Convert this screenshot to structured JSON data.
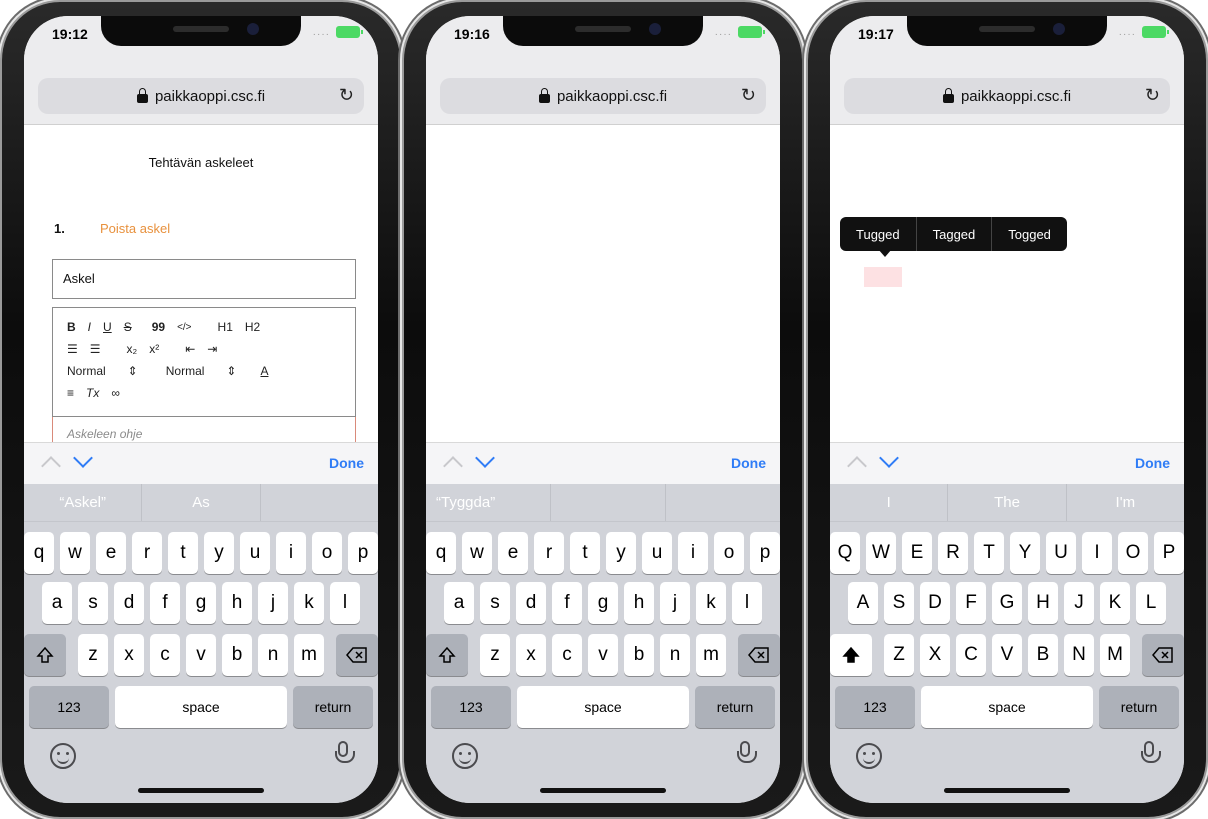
{
  "phones": [
    {
      "time": "19:12",
      "url": "paikkaoppi.csc.fi",
      "content": {
        "title": "Tehtävän askeleet",
        "step_number": "1.",
        "remove_step": "Poista askel",
        "input_value": "Askel",
        "toolbar": {
          "bold": "B",
          "italic": "I",
          "underline": "U",
          "strike": "S",
          "quote": "99",
          "code": "</>",
          "h1": "H1",
          "h2": "H2",
          "subscript": "x₂",
          "superscript": "x²",
          "size_select": "Normal",
          "font_select": "Normal",
          "font_color": "A",
          "clear_format": "Tx"
        },
        "editor_placeholder": "Askeleen ohje"
      },
      "done": "Done",
      "suggestions": [
        "“Askel”",
        "As",
        ""
      ],
      "keys": {
        "row1": [
          "q",
          "w",
          "e",
          "r",
          "t",
          "y",
          "u",
          "i",
          "o",
          "p"
        ],
        "row2": [
          "a",
          "s",
          "d",
          "f",
          "g",
          "h",
          "j",
          "k",
          "l"
        ],
        "row3": [
          "z",
          "x",
          "c",
          "v",
          "b",
          "n",
          "m"
        ],
        "num": "123",
        "space": "space",
        "return": "return"
      }
    },
    {
      "time": "19:16",
      "url": "paikkaoppi.csc.fi",
      "done": "Done",
      "suggestions": [
        "“Tyggda”",
        "",
        ""
      ],
      "keys": {
        "row1": [
          "q",
          "w",
          "e",
          "r",
          "t",
          "y",
          "u",
          "i",
          "o",
          "p"
        ],
        "row2": [
          "a",
          "s",
          "d",
          "f",
          "g",
          "h",
          "j",
          "k",
          "l"
        ],
        "row3": [
          "z",
          "x",
          "c",
          "v",
          "b",
          "n",
          "m"
        ],
        "num": "123",
        "space": "space",
        "return": "return"
      }
    },
    {
      "time": "19:17",
      "url": "paikkaoppi.csc.fi",
      "popup": [
        "Tugged",
        "Tagged",
        "Togged"
      ],
      "done": "Done",
      "suggestions": [
        "I",
        "The",
        "I'm"
      ],
      "keys": {
        "row1": [
          "Q",
          "W",
          "E",
          "R",
          "T",
          "Y",
          "U",
          "I",
          "O",
          "P"
        ],
        "row2": [
          "A",
          "S",
          "D",
          "F",
          "G",
          "H",
          "J",
          "K",
          "L"
        ],
        "row3": [
          "Z",
          "X",
          "C",
          "V",
          "B",
          "N",
          "M"
        ],
        "num": "123",
        "space": "space",
        "return": "return"
      }
    }
  ]
}
